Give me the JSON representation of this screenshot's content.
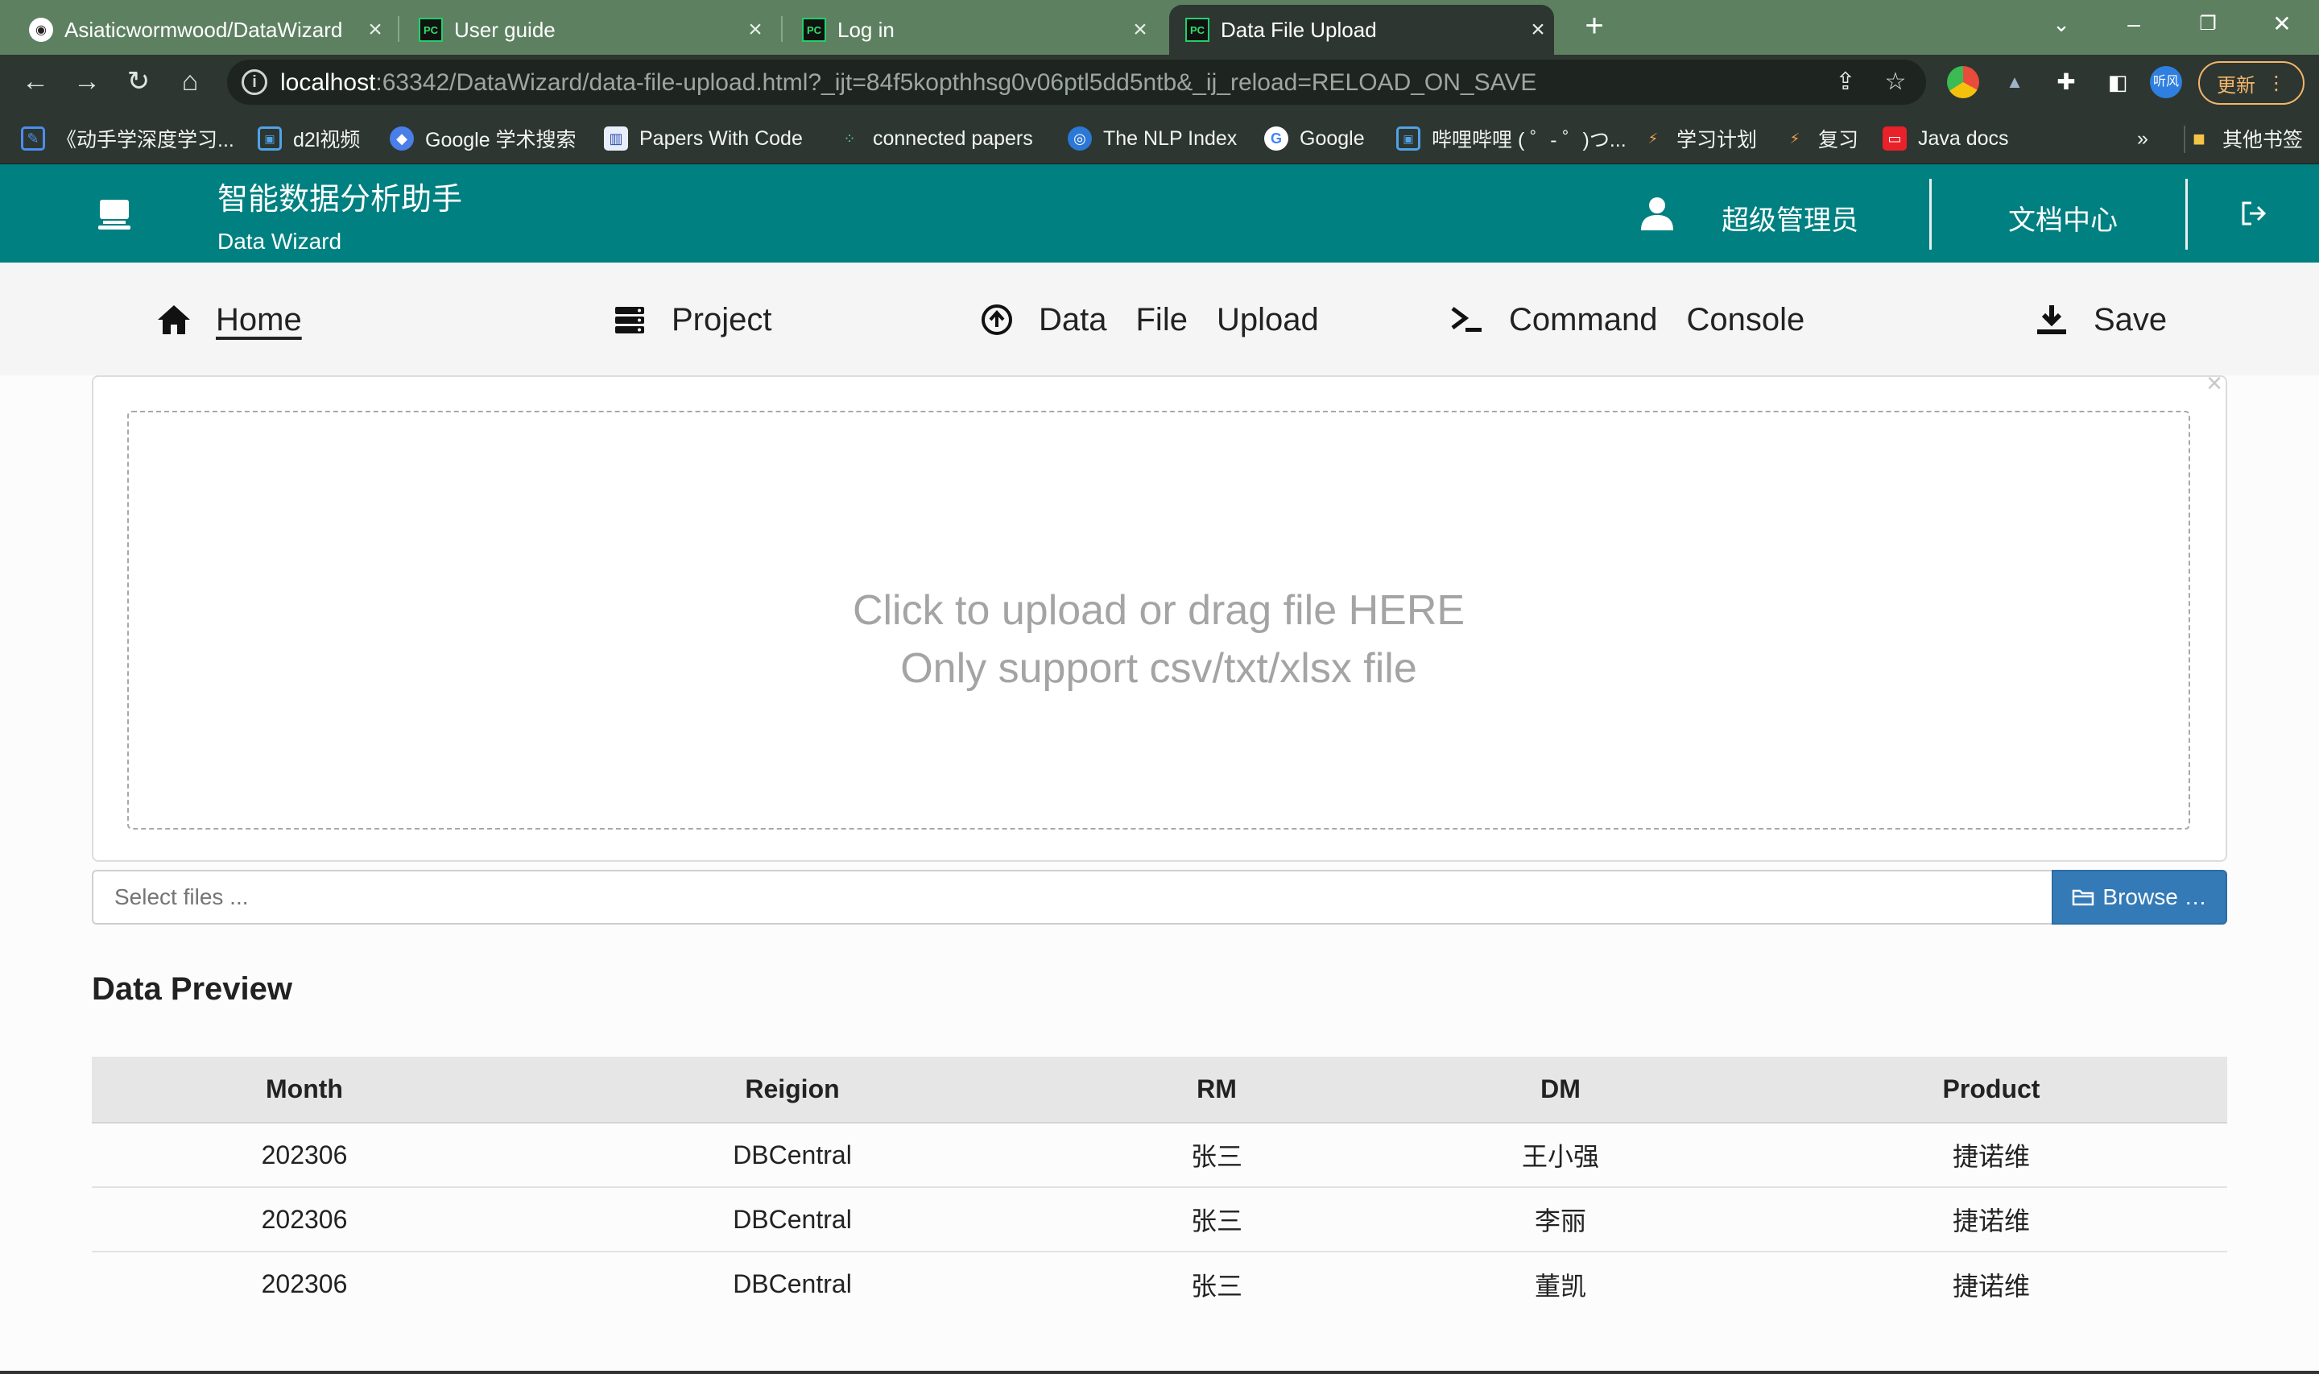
{
  "browser": {
    "tabs": [
      {
        "title": "Asiaticwormwood/DataWizard",
        "icon": "github-icon"
      },
      {
        "title": "User guide",
        "icon": "pycharm-icon"
      },
      {
        "title": "Log in",
        "icon": "pycharm-icon"
      },
      {
        "title": "Data File Upload",
        "icon": "pycharm-icon",
        "active": true
      }
    ],
    "url_host": "localhost",
    "url_rest": ":63342/DataWizard/data-file-upload.html?_ijt=84f5kopthhsg0v06ptl5dd5ntb&_ij_reload=RELOAD_ON_SAVE",
    "update_label": "更新",
    "profile_label": "听风",
    "bookmarks": [
      {
        "label": "《动手学深度学习...",
        "icon": "book-icon"
      },
      {
        "label": "d2l视频",
        "icon": "bilibili-icon"
      },
      {
        "label": "Google 学术搜索",
        "icon": "scholar-icon"
      },
      {
        "label": "Papers With Code",
        "icon": "paperswithcode-icon"
      },
      {
        "label": "connected papers",
        "icon": "graph-icon"
      },
      {
        "label": "The NLP Index",
        "icon": "nlp-index-icon"
      },
      {
        "label": "Google",
        "icon": "google-icon"
      },
      {
        "label": "哔哩哔哩 ( ゜- ゜)つ...",
        "icon": "bilibili-icon"
      },
      {
        "label": "学习计划",
        "icon": "plan-icon"
      },
      {
        "label": "复习",
        "icon": "review-icon"
      },
      {
        "label": "Java docs",
        "icon": "oracle-icon"
      }
    ],
    "more_bookmarks": "»",
    "other_bookmarks": "其他书签"
  },
  "header": {
    "title": "智能数据分析助手",
    "subtitle": "Data Wizard",
    "user": "超级管理员",
    "docs": "文档中心",
    "color": "#008080"
  },
  "nav": {
    "home": "Home",
    "project": "Project",
    "upload_words": [
      "Data",
      "File",
      "Upload"
    ],
    "command_words": [
      "Command",
      "Console"
    ],
    "save": "Save"
  },
  "upload": {
    "line1": "Click to upload or drag file HERE",
    "line2": "Only support csv/txt/xlsx file",
    "placeholder": "Select files ...",
    "browse": "Browse …",
    "close": "×"
  },
  "preview": {
    "title": "Data Preview",
    "columns": [
      "Month",
      "Reigion",
      "RM",
      "DM",
      "Product"
    ],
    "rows": [
      [
        "202306",
        "DBCentral",
        "张三",
        "王小强",
        "捷诺维"
      ],
      [
        "202306",
        "DBCentral",
        "张三",
        "李丽",
        "捷诺维"
      ],
      [
        "202306",
        "DBCentral",
        "张三",
        "董凯",
        "捷诺维"
      ]
    ]
  }
}
